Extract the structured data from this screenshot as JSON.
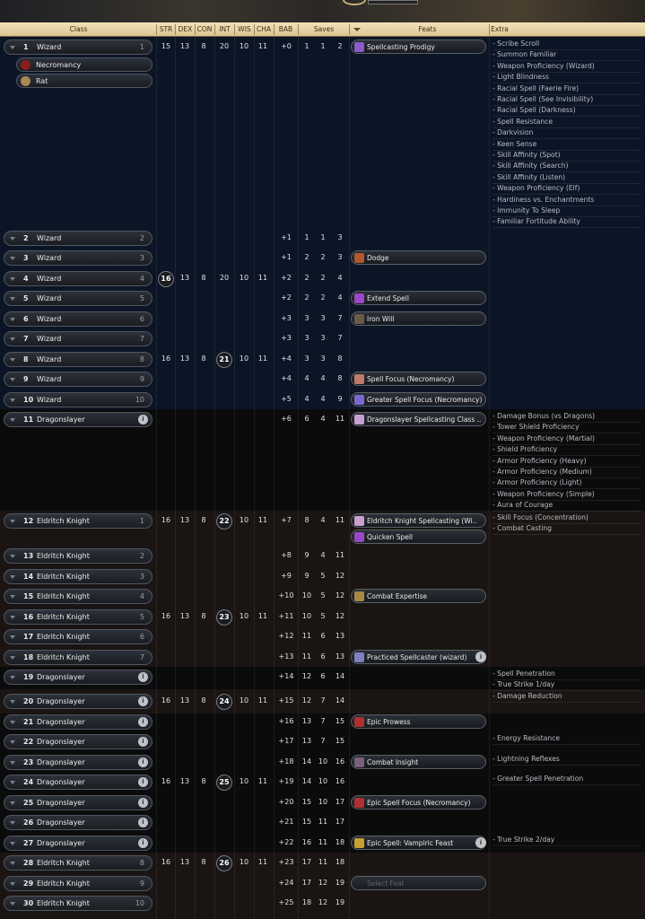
{
  "header": {
    "class": "Class",
    "str": "STR",
    "dex": "DEX",
    "con": "CON",
    "int": "INT",
    "wis": "WIS",
    "cha": "CHA",
    "bab": "BAB",
    "saves": "Saves",
    "feats": "Feats",
    "extra": "Extra"
  },
  "colors": {
    "wizard_band": "#0c1526",
    "dragon_band": "#0b0b0c",
    "eldritch_band": "#1a1513",
    "header_bg": "#ecd9a9"
  },
  "sub_entries": [
    {
      "label": "Necromancy",
      "icon": "necromancy-school-icon",
      "color": "#8a1c1c"
    },
    {
      "label": "Rat",
      "icon": "rat-familiar-icon",
      "color": "#a88a55"
    }
  ],
  "rows": [
    {
      "lvl": "1",
      "cls": "Wizard",
      "cl": "1",
      "stats": [
        "15",
        "13",
        "8",
        "20",
        "10",
        "11"
      ],
      "bab": "+0",
      "saves": [
        "1",
        "1",
        "2"
      ],
      "feats": [
        {
          "name": "Spellcasting Prodigy",
          "color": "#8a5ac8"
        }
      ]
    },
    {
      "lvl": "2",
      "cls": "Wizard",
      "cl": "2",
      "bab": "+1",
      "saves": [
        "1",
        "1",
        "3"
      ],
      "feats": []
    },
    {
      "lvl": "3",
      "cls": "Wizard",
      "cl": "3",
      "bab": "+1",
      "saves": [
        "2",
        "2",
        "3"
      ],
      "feats": [
        {
          "name": "Dodge",
          "color": "#b0582c"
        }
      ]
    },
    {
      "lvl": "4",
      "cls": "Wizard",
      "cl": "4",
      "stats": [
        "16",
        "13",
        "8",
        "20",
        "10",
        "11"
      ],
      "circled": 0,
      "bab": "+2",
      "saves": [
        "2",
        "2",
        "4"
      ],
      "feats": []
    },
    {
      "lvl": "5",
      "cls": "Wizard",
      "cl": "5",
      "bab": "+2",
      "saves": [
        "2",
        "2",
        "4"
      ],
      "feats": [
        {
          "name": "Extend Spell",
          "color": "#9a48c8"
        }
      ]
    },
    {
      "lvl": "6",
      "cls": "Wizard",
      "cl": "6",
      "bab": "+3",
      "saves": [
        "3",
        "3",
        "7"
      ],
      "feats": [
        {
          "name": "Iron Will",
          "color": "#6a5a48"
        }
      ]
    },
    {
      "lvl": "7",
      "cls": "Wizard",
      "cl": "7",
      "bab": "+3",
      "saves": [
        "3",
        "3",
        "7"
      ],
      "feats": []
    },
    {
      "lvl": "8",
      "cls": "Wizard",
      "cl": "8",
      "stats": [
        "16",
        "13",
        "8",
        "21",
        "10",
        "11"
      ],
      "circled": 3,
      "bab": "+4",
      "saves": [
        "3",
        "3",
        "8"
      ],
      "feats": []
    },
    {
      "lvl": "9",
      "cls": "Wizard",
      "cl": "9",
      "bab": "+4",
      "saves": [
        "4",
        "4",
        "8"
      ],
      "feats": [
        {
          "name": "Spell Focus (Necromancy)",
          "color": "#c07a6a"
        }
      ]
    },
    {
      "lvl": "10",
      "cls": "Wizard",
      "cl": "10",
      "bab": "+5",
      "saves": [
        "4",
        "4",
        "9"
      ],
      "feats": [
        {
          "name": "Greater Spell Focus (Necromancy)",
          "color": "#7a6ad0"
        }
      ]
    },
    {
      "lvl": "11",
      "cls": "Dragonslayer",
      "info": true,
      "bab": "+6",
      "saves": [
        "6",
        "4",
        "11"
      ],
      "feats": [
        {
          "name": "Dragonslayer Spellcasting Class ..",
          "color": "#c8a0d0"
        }
      ]
    },
    {
      "lvl": "12",
      "cls": "Eldritch Knight",
      "cl": "1",
      "stats": [
        "16",
        "13",
        "8",
        "22",
        "10",
        "11"
      ],
      "circled": 3,
      "bab": "+7",
      "saves": [
        "8",
        "4",
        "11"
      ],
      "feats": [
        {
          "name": "Eldritch Knight Spellcasting (Wi..",
          "color": "#c8a0d0"
        },
        {
          "name": "Quicken Spell",
          "color": "#9a48c8"
        }
      ]
    },
    {
      "lvl": "13",
      "cls": "Eldritch Knight",
      "cl": "2",
      "bab": "+8",
      "saves": [
        "9",
        "4",
        "11"
      ],
      "feats": []
    },
    {
      "lvl": "14",
      "cls": "Eldritch Knight",
      "cl": "3",
      "bab": "+9",
      "saves": [
        "9",
        "5",
        "12"
      ],
      "feats": []
    },
    {
      "lvl": "15",
      "cls": "Eldritch Knight",
      "cl": "4",
      "bab": "+10",
      "saves": [
        "10",
        "5",
        "12"
      ],
      "feats": [
        {
          "name": "Combat Expertise",
          "color": "#a88a45"
        }
      ]
    },
    {
      "lvl": "16",
      "cls": "Eldritch Knight",
      "cl": "5",
      "stats": [
        "16",
        "13",
        "8",
        "23",
        "10",
        "11"
      ],
      "circled": 3,
      "bab": "+11",
      "saves": [
        "10",
        "5",
        "12"
      ],
      "feats": []
    },
    {
      "lvl": "17",
      "cls": "Eldritch Knight",
      "cl": "6",
      "bab": "+12",
      "saves": [
        "11",
        "6",
        "13"
      ],
      "feats": []
    },
    {
      "lvl": "18",
      "cls": "Eldritch Knight",
      "cl": "7",
      "bab": "+13",
      "saves": [
        "11",
        "6",
        "13"
      ],
      "feats": [
        {
          "name": "Practiced Spellcaster (wizard)",
          "color": "#8080c0",
          "info": true
        }
      ]
    },
    {
      "lvl": "19",
      "cls": "Dragonslayer",
      "info": true,
      "bab": "+14",
      "saves": [
        "12",
        "6",
        "14"
      ],
      "feats": []
    },
    {
      "lvl": "20",
      "cls": "Dragonslayer",
      "info": true,
      "stats": [
        "16",
        "13",
        "8",
        "24",
        "10",
        "11"
      ],
      "circled": 3,
      "bab": "+15",
      "saves": [
        "12",
        "7",
        "14"
      ],
      "feats": []
    },
    {
      "lvl": "21",
      "cls": "Dragonslayer",
      "info": true,
      "bab": "+16",
      "saves": [
        "13",
        "7",
        "15"
      ],
      "feats": [
        {
          "name": "Epic Prowess",
          "color": "#b03030"
        }
      ]
    },
    {
      "lvl": "22",
      "cls": "Dragonslayer",
      "info": true,
      "bab": "+17",
      "saves": [
        "13",
        "7",
        "15"
      ],
      "feats": []
    },
    {
      "lvl": "23",
      "cls": "Dragonslayer",
      "info": true,
      "bab": "+18",
      "saves": [
        "14",
        "10",
        "16"
      ],
      "feats": [
        {
          "name": "Combat Insight",
          "color": "#7a6078"
        }
      ]
    },
    {
      "lvl": "24",
      "cls": "Dragonslayer",
      "info": true,
      "stats": [
        "16",
        "13",
        "8",
        "25",
        "10",
        "11"
      ],
      "circled": 3,
      "bab": "+19",
      "saves": [
        "14",
        "10",
        "16"
      ],
      "feats": []
    },
    {
      "lvl": "25",
      "cls": "Dragonslayer",
      "info": true,
      "bab": "+20",
      "saves": [
        "15",
        "10",
        "17"
      ],
      "feats": [
        {
          "name": "Epic Spell Focus (Necromancy)",
          "color": "#b03030"
        }
      ]
    },
    {
      "lvl": "26",
      "cls": "Dragonslayer",
      "info": true,
      "bab": "+21",
      "saves": [
        "15",
        "11",
        "17"
      ],
      "feats": []
    },
    {
      "lvl": "27",
      "cls": "Dragonslayer",
      "info": true,
      "bab": "+22",
      "saves": [
        "16",
        "11",
        "18"
      ],
      "feats": [
        {
          "name": "Epic Spell: Vampiric Feast",
          "color": "#c8a030",
          "info": true
        }
      ]
    },
    {
      "lvl": "28",
      "cls": "Eldritch Knight",
      "cl": "8",
      "stats": [
        "16",
        "13",
        "8",
        "26",
        "10",
        "11"
      ],
      "circled": 3,
      "bab": "+23",
      "saves": [
        "17",
        "11",
        "18"
      ],
      "feats": []
    },
    {
      "lvl": "29",
      "cls": "Eldritch Knight",
      "cl": "9",
      "bab": "+24",
      "saves": [
        "17",
        "12",
        "19"
      ],
      "feats": [
        {
          "name": "Select Feat",
          "empty": true
        }
      ]
    },
    {
      "lvl": "30",
      "cls": "Eldritch Knight",
      "cl": "10",
      "bab": "+25",
      "saves": [
        "18",
        "12",
        "19"
      ],
      "feats": []
    }
  ],
  "extras": [
    {
      "row": 0,
      "items": [
        "- Scribe Scroll",
        "- Summon Familiar",
        "- Weapon Proficiency (Wizard)",
        "- Light Blindness",
        "- Racial Spell (Faerie Fire)",
        "- Racial Spell (See Invisibility)",
        "- Racial Spell (Darkness)",
        "- Spell Resistance",
        "- Darkvision",
        "- Keen Sense",
        "- Skill Affinity (Spot)",
        "- Skill Affinity (Search)",
        "- Skill Affinity (Listen)",
        "- Weapon Proficiency (Elf)",
        "- Hardiness vs. Enchantments",
        "- Immunity To Sleep",
        "- Familiar Fortitude Ability"
      ]
    },
    {
      "row": 10,
      "items": [
        "- Damage Bonus (vs Dragons)",
        "- Tower Shield Proficiency",
        "- Weapon Proficiency (Martial)",
        "- Shield Proficiency",
        "- Armor Proficiency (Heavy)",
        "- Armor Proficiency (Medium)",
        "- Armor Proficiency (Light)",
        "- Weapon Proficiency (Simple)",
        "- Aura of Courage"
      ]
    },
    {
      "row": 11,
      "items": [
        "- Skill Focus (Concentration)",
        "- Combat Casting"
      ]
    },
    {
      "row": 18,
      "items": [
        "- Spell Penetration",
        "- True Strike 1/day",
        "- Damage Reduction"
      ]
    },
    {
      "row": 21,
      "items": [
        "- Energy Resistance"
      ]
    },
    {
      "row": 22,
      "items": [
        "- Lightning Reflexes"
      ]
    },
    {
      "row": 23,
      "items": [
        "- Greater Spell Penetration"
      ]
    },
    {
      "row": 26,
      "items": [
        "- True Strike 2/day"
      ]
    }
  ]
}
